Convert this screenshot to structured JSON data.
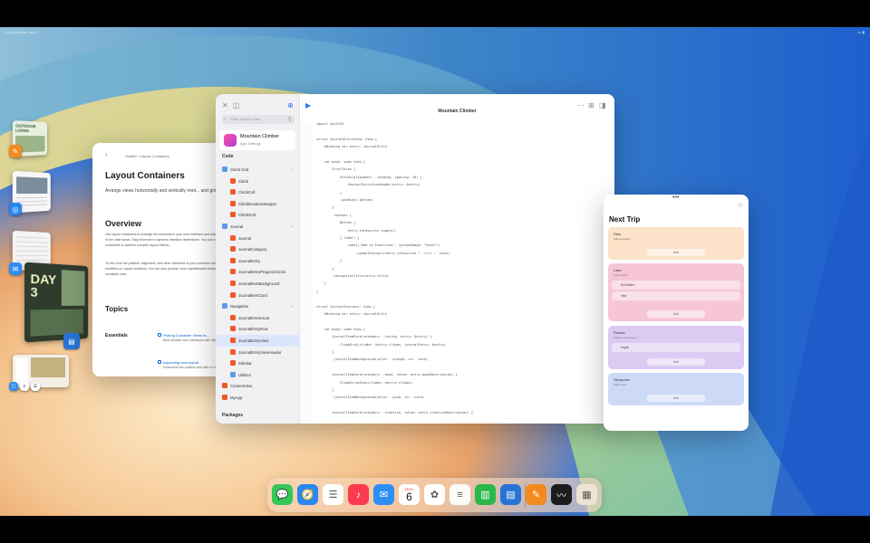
{
  "status_bar": {
    "time": "9:41 AM  Mon Jun 5",
    "indicators": "••• ▮"
  },
  "stage_manager": {
    "items": [
      "OUTDOOR LIVING",
      "DAY 3"
    ]
  },
  "documentation": {
    "breadcrumb": "SwiftUI  ›  Layout Containers",
    "title": "Layout Containers",
    "subtitle": "Arrange views horizontally and vertically mod... and grids.",
    "overview_heading": "Overview",
    "overview_p1": "Use layout containers to arrange the elements in your user interface and adjust the positions of the child views. Stay informed to dynamic interface dimensions. You can nest layout containers to achieve complex layout effects.",
    "overview_p2": "To fine tune the position, alignment, and other elements of your container views, use the view modifiers in Layout modifiers. You can also provide more sophisticated behavior, like a list of a scrollable view.",
    "topics_heading": "Topics",
    "essentials_label": "Essentials",
    "topics": [
      {
        "title": "Picking Container Views fo...",
        "desc": "Build flexible user interfaces with lists and forms."
      },
      {
        "title": "Inspecting view layout",
        "desc": "Determine the position and size of views."
      }
    ]
  },
  "xcode": {
    "title": "Mountain Climber",
    "search_placeholder": "Filter Source Files",
    "app": {
      "name": "Mountain Climber",
      "subtitle": "App Settings"
    },
    "code_section": "Code",
    "packages_section": "Packages",
    "tree": [
      {
        "label": "Climb Grid",
        "kind": "folder",
        "indent": 0,
        "chevron": "⌄"
      },
      {
        "label": "Climb",
        "kind": "swift",
        "indent": 1
      },
      {
        "label": "ClimbCell",
        "kind": "swift",
        "indent": 1
      },
      {
        "label": "ClimbDurationStepper",
        "kind": "swift",
        "indent": 1
      },
      {
        "label": "ClimbGrid",
        "kind": "swift",
        "indent": 1
      },
      {
        "label": "Journal",
        "kind": "folder",
        "indent": 0,
        "chevron": "⌄"
      },
      {
        "label": "Journal",
        "kind": "swift",
        "indent": 1
      },
      {
        "label": "JournalCategory",
        "kind": "swift",
        "indent": 1
      },
      {
        "label": "JournalEntry",
        "kind": "swift",
        "indent": 1
      },
      {
        "label": "JournalEntryProgressCircle",
        "kind": "swift",
        "indent": 1
      },
      {
        "label": "JournalItemBackground",
        "kind": "swift",
        "indent": 1
      },
      {
        "label": "JournalItemCard",
        "kind": "swift",
        "indent": 1
      },
      {
        "label": "Navigation",
        "kind": "folder",
        "indent": 0,
        "chevron": "⌄"
      },
      {
        "label": "JournalEntriesList",
        "kind": "swift",
        "indent": 1
      },
      {
        "label": "JournalEntryRow",
        "kind": "swift",
        "indent": 1
      },
      {
        "label": "JournalEntryView",
        "kind": "swift",
        "indent": 1,
        "selected": true
      },
      {
        "label": "JournalEntryViewHeader",
        "kind": "swift",
        "indent": 1
      },
      {
        "label": "Sidebar",
        "kind": "swift",
        "indent": 1
      },
      {
        "label": "Utilities",
        "kind": "folder",
        "indent": 1
      },
      {
        "label": "ContentView",
        "kind": "swift",
        "indent": 0
      },
      {
        "label": "MyApp",
        "kind": "swift",
        "indent": 0
      }
    ],
    "code": [
      "import SwiftUI",
      "",
      "struct JournalEntryView: View {",
      "    @Binding var entry: JournalEntry",
      "",
      "    var body: some View {",
      "        ScrollView {",
      "            VStack(alignment: .leading, spacing: 20) {",
      "                JournalEntryViewHeader(entry: $entry)",
      "            }",
      "            .padding(.bottom)",
      "        }",
      "        .toolbar {",
      "            Button {",
      "                entry.isFavorite.toggle()",
      "            } label: {",
      "                Label(\"Add to Favorites\", systemImage: \"heart\")",
      "                    .symbolVariant(entry.isFavorite ? .fill : .none)",
      "            }",
      "        }",
      "        .navigationTitle(entry.title)",
      "    }",
      "}",
      "",
      "struct JournalSections: View {",
      "    @Binding var entry: JournalEntry",
      "",
      "    var body: some View {",
      "        JournalItemCard(category: .rating, entry: $entry) {",
      "            ClimbGrid(climbs: $entry.climbs, journalEntry: $entry)",
      "        }",
      "        .journalItemBackground(color: .orange, in: .card)",
      "",
      "        JournalItemCard(category: .mood, value: entry.moodDescription) {",
      "            ClimbStripView(climbs: $entry.climbs)",
      "        }",
      "        .journalItemBackground(color: .pink, in: .card)",
      "",
      "        JournalItemCard(category: .creative, value: entry.creativeDescription) {"
    ]
  },
  "trip": {
    "title": "Next Trip",
    "cards": [
      {
        "name": "Plan",
        "sub": "Add a location",
        "rows": [],
        "button": "Add",
        "color": "#fbe2c8"
      },
      {
        "name": "Lake",
        "sub": "Add activity",
        "rows": [
          "Bird Watch",
          "Hike"
        ],
        "button": "Add",
        "color": "#f6c6d7"
      },
      {
        "name": "Photos",
        "sub": "Capture and export",
        "rows": [
          "Kayak"
        ],
        "button": "Add",
        "color": "#dccaf3"
      },
      {
        "name": "Sleepover",
        "sub": "Add a note",
        "rows": [],
        "button": "Add",
        "color": "#cddaf7"
      }
    ]
  },
  "dock": {
    "apps": [
      {
        "name": "messages-icon",
        "glyph": "💬",
        "bg": "#35c759"
      },
      {
        "name": "safari-icon",
        "glyph": "🧭",
        "bg": "#2a86f0"
      },
      {
        "name": "reminders-icon",
        "glyph": "☰",
        "bg": "#ffffff"
      },
      {
        "name": "music-icon",
        "glyph": "♪",
        "bg": "#fa3b4f"
      },
      {
        "name": "mail-icon",
        "glyph": "✉",
        "bg": "#2d8ef5"
      },
      {
        "name": "calendar-icon",
        "glyph": "6",
        "bg": "#ffffff"
      },
      {
        "name": "photos-icon",
        "glyph": "✿",
        "bg": "#ffffff"
      },
      {
        "name": "notes-icon",
        "glyph": "≡",
        "bg": "#fbfbf7"
      },
      {
        "name": "numbers-icon",
        "glyph": "▥",
        "bg": "#29b84a"
      },
      {
        "name": "keynote-icon",
        "glyph": "▤",
        "bg": "#2774d6"
      },
      {
        "name": "pages-icon",
        "glyph": "✎",
        "bg": "#f58a1c"
      },
      {
        "name": "freeform-icon",
        "glyph": "〰",
        "bg": "#1c1c1e"
      },
      {
        "name": "app-library-icon",
        "glyph": "▦",
        "bg": "#f0e2d4"
      }
    ],
    "calendar_day": "MON",
    "calendar_date": "6"
  }
}
